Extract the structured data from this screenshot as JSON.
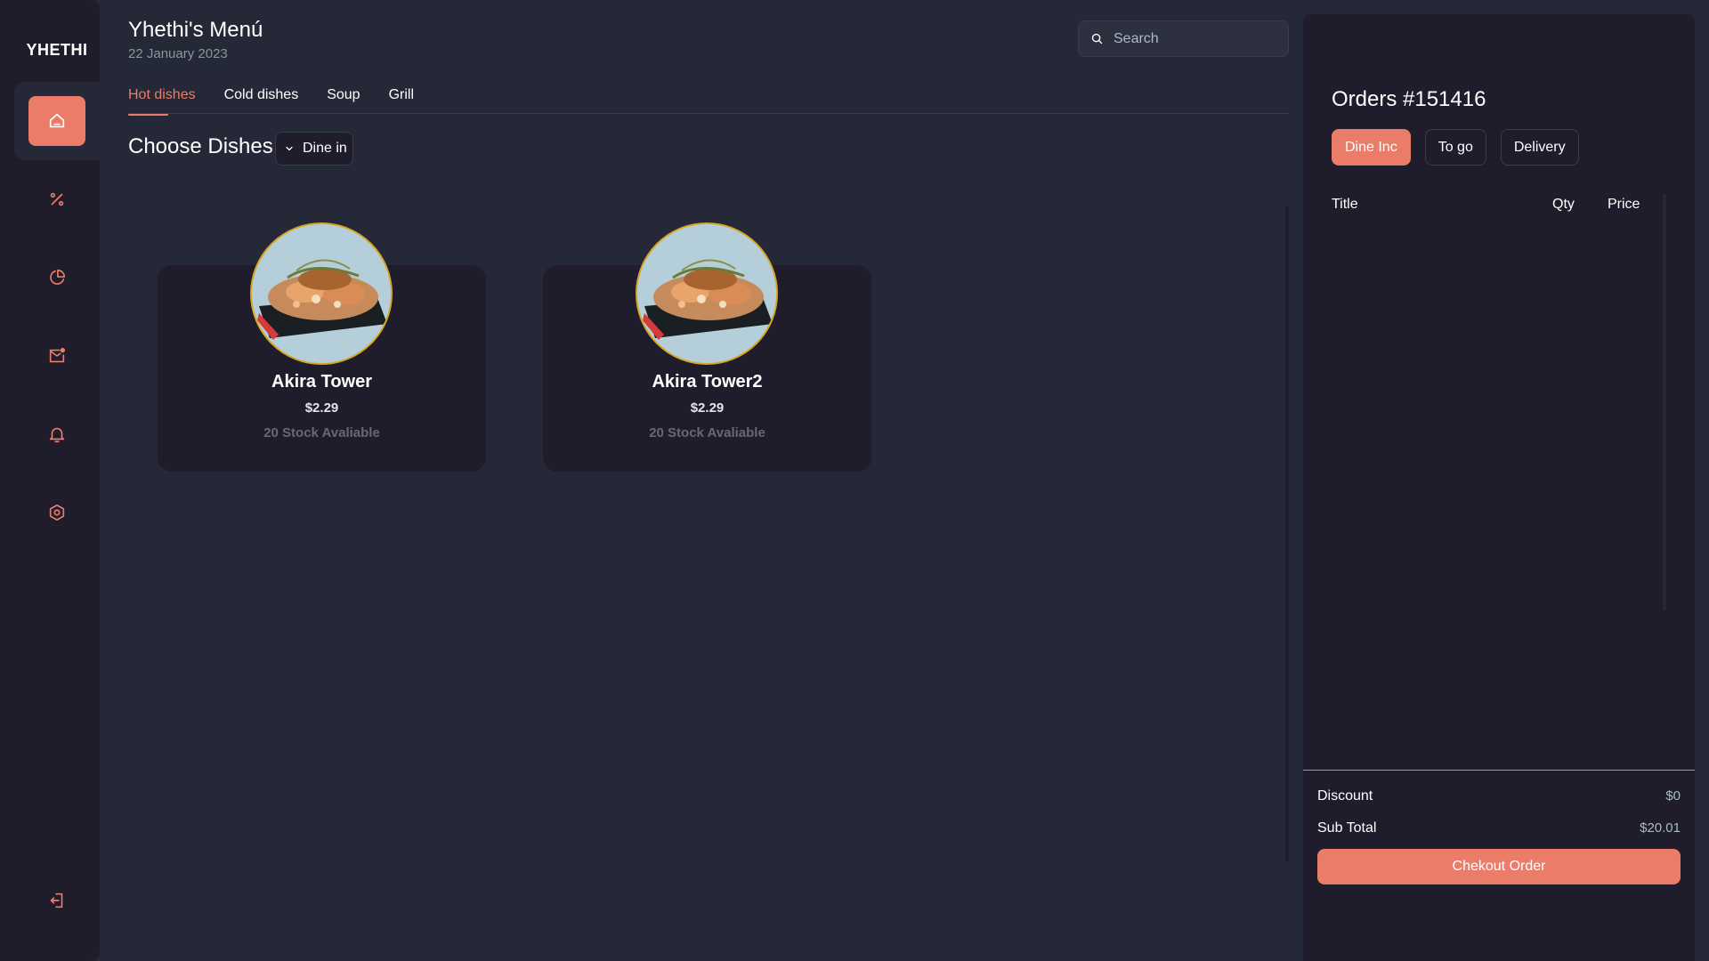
{
  "app": {
    "logo": "YHETHI"
  },
  "header": {
    "title": "Yhethi's Menú",
    "date": "22 January 2023",
    "search_placeholder": "Search"
  },
  "sidebar": {
    "items": [
      {
        "name": "home",
        "icon": "home-icon"
      },
      {
        "name": "discount",
        "icon": "percent-icon"
      },
      {
        "name": "dashboard",
        "icon": "pie-chart-icon"
      },
      {
        "name": "messages",
        "icon": "mail-icon"
      },
      {
        "name": "notifications",
        "icon": "bell-icon"
      },
      {
        "name": "settings",
        "icon": "settings-icon"
      }
    ],
    "logout_icon": "logout-icon"
  },
  "tabs": [
    "Hot dishes",
    "Cold dishes",
    "Soup",
    "Grill"
  ],
  "section": {
    "title": "Choose Dishes",
    "dine_option": "Dine in"
  },
  "dishes": [
    {
      "name": "Akira Tower",
      "price": "$2.29",
      "stock": "20 Stock Avaliable"
    },
    {
      "name": "Akira Tower2",
      "price": "$2.29",
      "stock": "20 Stock Avaliable"
    }
  ],
  "order": {
    "title": "Orders #151416",
    "types": [
      "Dine Inc",
      "To go",
      "Delivery"
    ],
    "columns": {
      "title": "Title",
      "qty": "Qty",
      "price": "Price"
    },
    "discount_label": "Discount",
    "discount_value": "$0",
    "subtotal_label": "Sub Total",
    "subtotal_value": "$20.01",
    "checkout_label": "Chekout Order"
  },
  "colors": {
    "accent": "#ea7c69",
    "background": "#252836",
    "panel": "#1f1d2b",
    "plate_border": "#d9a520"
  }
}
